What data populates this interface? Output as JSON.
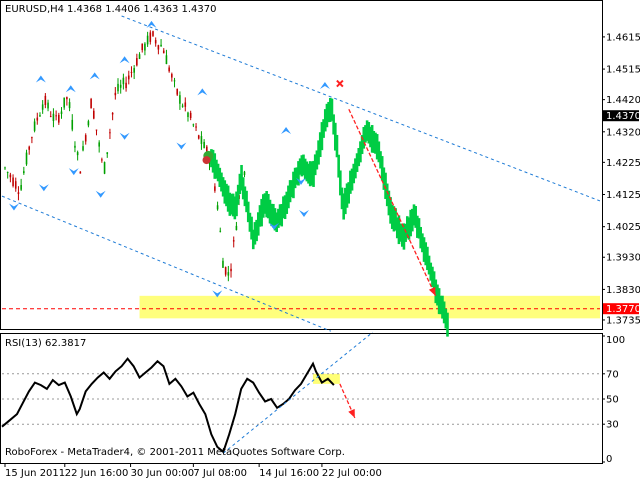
{
  "header": {
    "symbol": "EURUSD,H4",
    "ohlc": "1.4368 1.4406 1.4363 1.4370"
  },
  "rsi_header": {
    "label": "RSI(13) 62.3817"
  },
  "copyright": "RoboForex - MetaTrader4, © 2001-2011 MetaQuotes Software Corp.",
  "colors": {
    "up": "#00a000",
    "down": "#c00000",
    "forecast": "#00cc44",
    "channel": "#1e7bd6",
    "fractal": "#3399ff",
    "arrow": "#ff2020",
    "zone": "#ffff66",
    "rsi_line": "#000000",
    "price_tag_bg": "#000000",
    "level_tag_bg": "#ff0000"
  },
  "chart_data": [
    {
      "type": "candlestick",
      "name": "EURUSD,H4",
      "ylim": [
        1.371,
        1.468
      ],
      "price_ticks": [
        "1.4615",
        "1.4515",
        "1.4420",
        "1.4320",
        "1.4225",
        "1.4125",
        "1.4025",
        "1.3930",
        "1.3830",
        "1.3735"
      ],
      "current_price": "1.4370",
      "support_level": "1.3770",
      "x_ticks": [
        "15 Jun 2011",
        "22 Jun 16:00",
        "30 Jun 00:00",
        "7 Jul 08:00",
        "14 Jul 16:00",
        "22 Jul 00:00"
      ],
      "support_zone": [
        1.374,
        1.381
      ],
      "channel_upper": [
        {
          "x": 0.2,
          "y": 1.468
        },
        {
          "x": 1.0,
          "y": 1.4105
        }
      ],
      "channel_lower": [
        {
          "x": 0.0,
          "y": 1.412
        },
        {
          "x": 0.55,
          "y": 1.37
        }
      ],
      "forecast_arrow": [
        {
          "x": 0.58,
          "y": 1.439
        },
        {
          "x": 0.725,
          "y": 1.381
        }
      ],
      "cancel_mark": {
        "x": 0.565,
        "y": 1.447
      },
      "history": [
        [
          0,
          1.422
        ],
        [
          0.03,
          1.414
        ],
        [
          0.05,
          1.431
        ],
        [
          0.07,
          1.442
        ],
        [
          0.09,
          1.435
        ],
        [
          0.11,
          1.443
        ],
        [
          0.13,
          1.42
        ],
        [
          0.15,
          1.442
        ],
        [
          0.17,
          1.419
        ],
        [
          0.19,
          1.444
        ],
        [
          0.21,
          1.448
        ],
        [
          0.23,
          1.456
        ],
        [
          0.25,
          1.462
        ],
        [
          0.27,
          1.458
        ],
        [
          0.29,
          1.445
        ],
        [
          0.31,
          1.438
        ],
        [
          0.33,
          1.43
        ],
        [
          0.35,
          1.423
        ],
        [
          0.36,
          1.41
        ],
        [
          0.37,
          1.391
        ],
        [
          0.38,
          1.387
        ],
        [
          0.39,
          1.4
        ],
        [
          0.4,
          1.418
        ],
        [
          0.41,
          1.423
        ]
      ],
      "forecast_path": [
        [
          0.35,
          1.424
        ],
        [
          0.36,
          1.42
        ],
        [
          0.38,
          1.41
        ],
        [
          0.39,
          1.408
        ],
        [
          0.4,
          1.418
        ],
        [
          0.42,
          1.399
        ],
        [
          0.44,
          1.41
        ],
        [
          0.46,
          1.404
        ],
        [
          0.48,
          1.412
        ],
        [
          0.5,
          1.422
        ],
        [
          0.52,
          1.418
        ],
        [
          0.54,
          1.435
        ],
        [
          0.55,
          1.44
        ],
        [
          0.56,
          1.427
        ],
        [
          0.57,
          1.408
        ],
        [
          0.59,
          1.42
        ],
        [
          0.61,
          1.433
        ],
        [
          0.63,
          1.426
        ],
        [
          0.65,
          1.407
        ],
        [
          0.67,
          1.399
        ],
        [
          0.69,
          1.406
        ],
        [
          0.71,
          1.393
        ],
        [
          0.73,
          1.38
        ],
        [
          0.745,
          1.372
        ]
      ],
      "fractals_up": [
        [
          0.065,
          1.447
        ],
        [
          0.115,
          1.444
        ],
        [
          0.155,
          1.448
        ],
        [
          0.205,
          1.453
        ],
        [
          0.25,
          1.464
        ],
        [
          0.335,
          1.443
        ],
        [
          0.475,
          1.431
        ],
        [
          0.54,
          1.445
        ]
      ],
      "fractals_down": [
        [
          0.02,
          1.41
        ],
        [
          0.07,
          1.416
        ],
        [
          0.12,
          1.421
        ],
        [
          0.165,
          1.414
        ],
        [
          0.205,
          1.432
        ],
        [
          0.3,
          1.429
        ],
        [
          0.36,
          1.383
        ],
        [
          0.455,
          1.404
        ],
        [
          0.505,
          1.408
        ],
        [
          0.5,
          1.418
        ]
      ]
    },
    {
      "type": "line",
      "name": "RSI(13)",
      "value": 62.3817,
      "ylim": [
        0,
        100
      ],
      "levels": [
        70,
        50,
        30
      ],
      "y_ticks": [
        "100",
        "70",
        "50",
        "30",
        "0"
      ],
      "zone": {
        "x0": 0.52,
        "x1": 0.565,
        "y0": 62,
        "y1": 70
      },
      "trend_line": [
        {
          "x": 0.37,
          "y": 7
        },
        {
          "x": 0.62,
          "y": 103
        }
      ],
      "forecast_arrow": [
        {
          "x": 0.565,
          "y": 62
        },
        {
          "x": 0.59,
          "y": 35
        }
      ],
      "path": [
        [
          0.0,
          28
        ],
        [
          0.01,
          32
        ],
        [
          0.025,
          38
        ],
        [
          0.035,
          47
        ],
        [
          0.045,
          56
        ],
        [
          0.055,
          63
        ],
        [
          0.065,
          61
        ],
        [
          0.075,
          58
        ],
        [
          0.085,
          65
        ],
        [
          0.095,
          61
        ],
        [
          0.105,
          63
        ],
        [
          0.115,
          52
        ],
        [
          0.125,
          38
        ],
        [
          0.13,
          42
        ],
        [
          0.14,
          56
        ],
        [
          0.15,
          62
        ],
        [
          0.16,
          67
        ],
        [
          0.17,
          71
        ],
        [
          0.18,
          66
        ],
        [
          0.19,
          72
        ],
        [
          0.2,
          76
        ],
        [
          0.21,
          82
        ],
        [
          0.22,
          76
        ],
        [
          0.23,
          67
        ],
        [
          0.24,
          71
        ],
        [
          0.25,
          75
        ],
        [
          0.26,
          80
        ],
        [
          0.27,
          76
        ],
        [
          0.28,
          62
        ],
        [
          0.29,
          66
        ],
        [
          0.3,
          60
        ],
        [
          0.31,
          52
        ],
        [
          0.32,
          55
        ],
        [
          0.33,
          46
        ],
        [
          0.34,
          38
        ],
        [
          0.35,
          22
        ],
        [
          0.36,
          12
        ],
        [
          0.37,
          8
        ],
        [
          0.38,
          22
        ],
        [
          0.39,
          38
        ],
        [
          0.4,
          58
        ],
        [
          0.41,
          66
        ],
        [
          0.42,
          63
        ],
        [
          0.43,
          55
        ],
        [
          0.44,
          48
        ],
        [
          0.45,
          50
        ],
        [
          0.46,
          43
        ],
        [
          0.47,
          46
        ],
        [
          0.48,
          50
        ],
        [
          0.49,
          57
        ],
        [
          0.5,
          62
        ],
        [
          0.51,
          70
        ],
        [
          0.52,
          78
        ],
        [
          0.525,
          72
        ],
        [
          0.535,
          63
        ],
        [
          0.545,
          66
        ],
        [
          0.555,
          61
        ]
      ]
    }
  ]
}
